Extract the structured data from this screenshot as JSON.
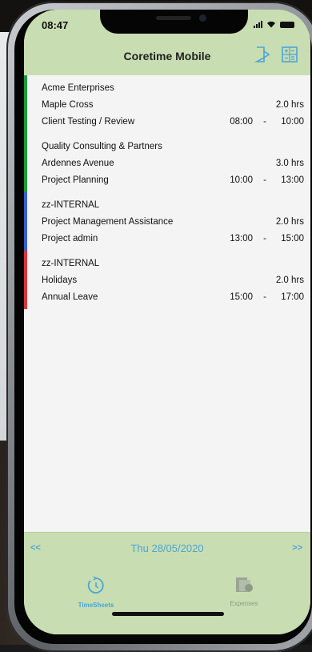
{
  "status": {
    "time": "08:47"
  },
  "header": {
    "title": "Coretime Mobile"
  },
  "entries": [
    {
      "client": "Acme Enterprises",
      "project": "Maple Cross",
      "hours": "2.0 hrs",
      "task": "Client Testing / Review",
      "start": "08:00",
      "sep": "-",
      "end": "10:00",
      "color": "#1e9a3c"
    },
    {
      "client": "Quality Consulting & Partners",
      "project": "Ardennes Avenue",
      "hours": "3.0 hrs",
      "task": "Project Planning",
      "start": "10:00",
      "sep": "-",
      "end": "13:00",
      "color": "#1e9a3c"
    },
    {
      "client": "zz-INTERNAL",
      "project": "Project Management Assistance",
      "hours": "2.0 hrs",
      "task": "Project admin",
      "start": "13:00",
      "sep": "-",
      "end": "15:00",
      "color": "#3b5fc9"
    },
    {
      "client": "zz-INTERNAL",
      "project": "Holidays",
      "hours": "2.0 hrs",
      "task": "Annual Leave",
      "start": "15:00",
      "sep": "-",
      "end": "17:00",
      "color": "#d9373d"
    }
  ],
  "datebar": {
    "prev": "<<",
    "date": "Thu 28/05/2020",
    "next": ">>"
  },
  "tabs": {
    "timesheets": {
      "label": "TimeSheets",
      "icon": "timer-icon"
    },
    "expenses": {
      "label": "Expenses",
      "icon": "money-icon"
    }
  },
  "colors": {
    "header": "#c8ddb1",
    "accent": "#4aa6d7"
  }
}
